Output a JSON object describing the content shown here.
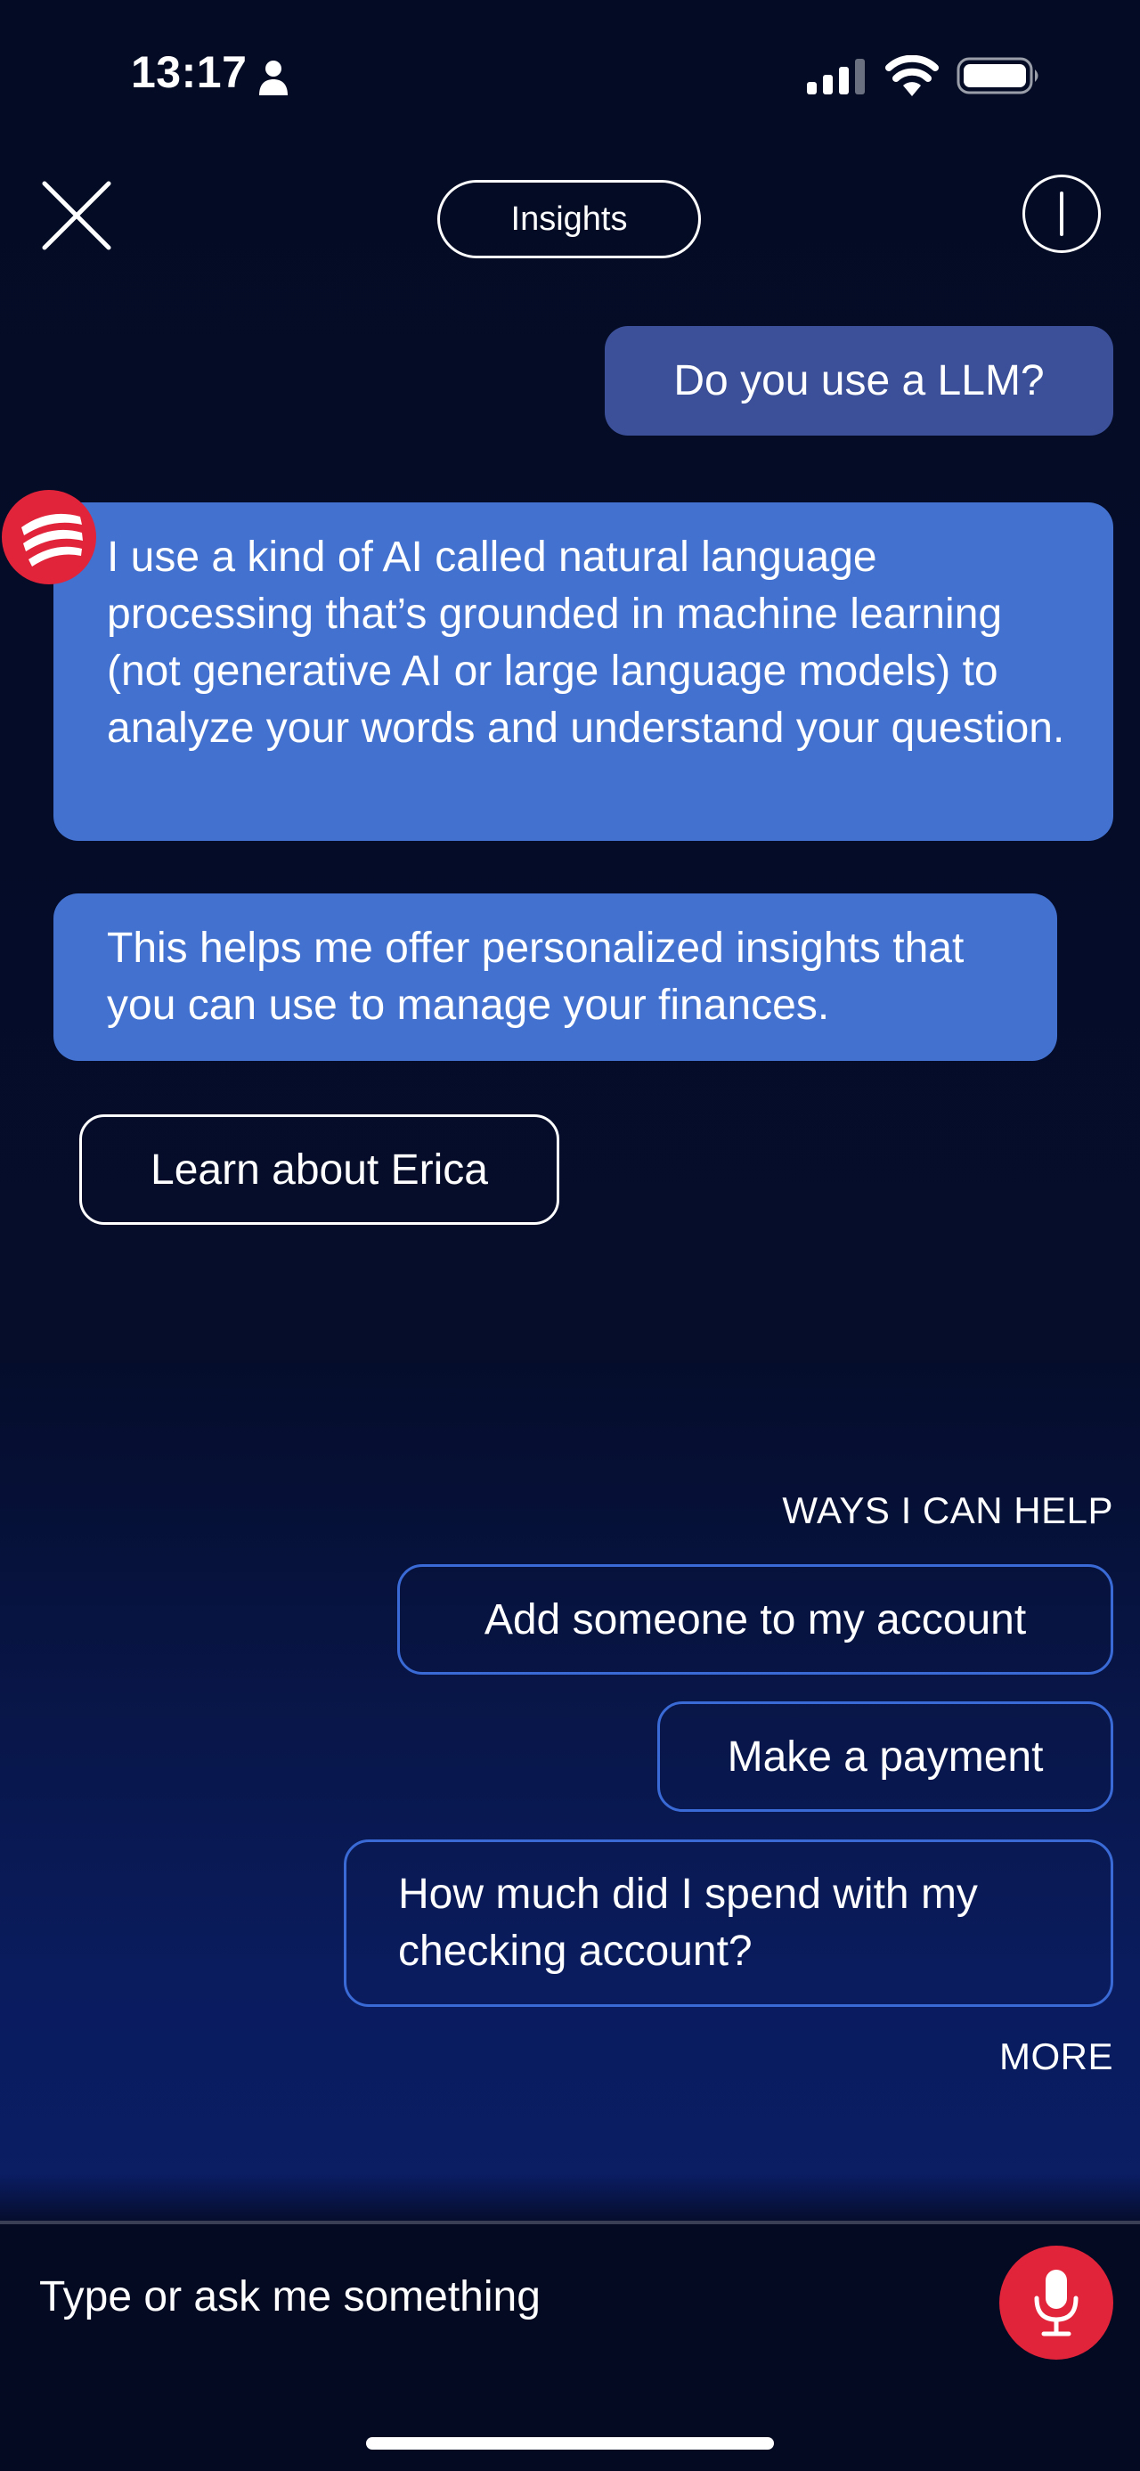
{
  "status_bar": {
    "time": "13:17",
    "icons": [
      "person-icon",
      "cellular-signal-icon",
      "wifi-icon",
      "battery-icon"
    ]
  },
  "header": {
    "close_icon": "close-icon",
    "title_button": "Insights",
    "info_icon": "info-icon"
  },
  "conversation": {
    "user_message": "Do you use a LLM?",
    "assistant_avatar_icon": "erica-logo-icon",
    "assistant_messages": [
      "I use a kind of AI called natural language processing that’s grounded in machine learning (not generative AI or large language models) to analyze your words and understand your question.",
      "This helps me offer personalized insights that you can use to manage your finances."
    ],
    "action_button": "Learn about Erica"
  },
  "suggestions": {
    "heading": "WAYS I CAN HELP",
    "items": [
      "Add someone to my account",
      "Make a payment",
      "How much did I spend with my checking account?"
    ],
    "more_label": "MORE"
  },
  "input_bar": {
    "placeholder": "Type or ask me something",
    "value": "",
    "mic_icon": "microphone-icon"
  },
  "colors": {
    "background_top": "#040b24",
    "background_glow": "#0b1d63",
    "user_bubble": "#3b5098",
    "assistant_bubble": "#4271cf",
    "suggestion_border": "#3a6ad6",
    "mic_button": "#e1243a"
  }
}
